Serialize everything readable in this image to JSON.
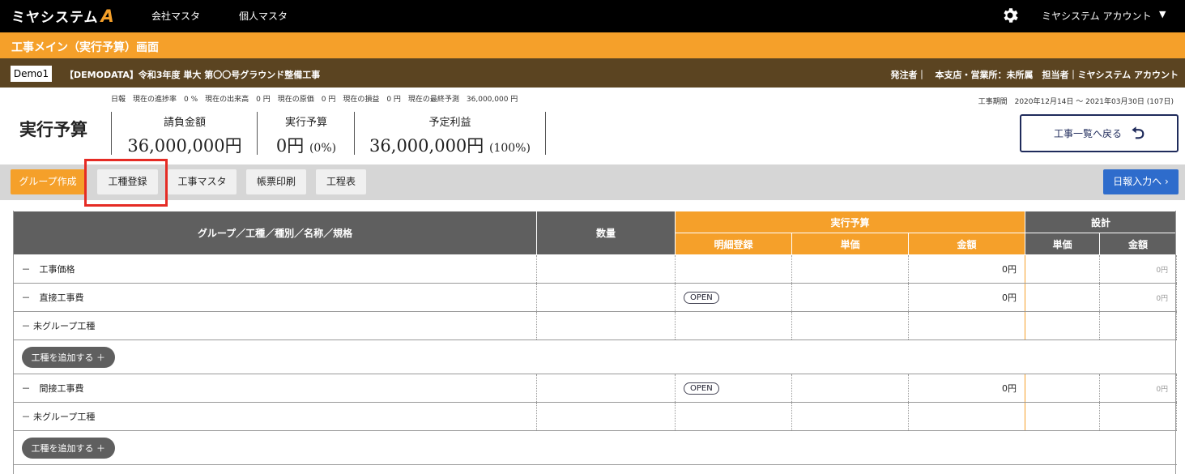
{
  "app": {
    "logo_text": "ミヤシステム",
    "logo_mark": "A"
  },
  "nav": {
    "items": [
      "会社マスタ",
      "個人マスタ"
    ]
  },
  "account": {
    "name": "ミヤシステム アカウント",
    "caret": "▼"
  },
  "screen_title": "工事メイン（実行予算）画面",
  "project_bar": {
    "demo_label": "Demo1",
    "project_name": "【DEMODATA】令和3年度 単大 第〇〇号グラウンド整備工事",
    "right_info": "発注者｜　本支店・営業所：未所属　担当者｜ミヤシステム アカウント"
  },
  "summary": {
    "status_line": "日報　現在の進捗率　0 %　現在の出来高　0 円　現在の原価　0 円　現在の損益　0 円　現在の最終予測　36,000,000 円",
    "period": "工事期間　2020年12月14日 〜 2021年03月30日 (107日)",
    "page_title": "実行予算",
    "metrics": [
      {
        "label": "請負金額",
        "value": "36,000,000円",
        "pct": ""
      },
      {
        "label": "実行予算",
        "value": "0円",
        "pct": "(0%)"
      },
      {
        "label": "予定利益",
        "value": "36,000,000円",
        "pct": "(100%)"
      }
    ],
    "back_button": "工事一覧へ戻る",
    "back_icon": "return-arrow-icon"
  },
  "toolbar": {
    "group_create": "グループ作成",
    "koshu_register": "工種登録",
    "koji_master": "工事マスタ",
    "report_print": "帳票印刷",
    "schedule": "工程表",
    "daily_input": "日報入力へ",
    "daily_input_arrow": "›"
  },
  "table": {
    "headers": {
      "name": "グループ／工種／種別／名称／規格",
      "qty": "数量",
      "budget": "実行予算",
      "detail": "明細登録",
      "unit_price": "単価",
      "amount": "金額",
      "design": "設計",
      "design_unit_price": "単価",
      "design_amount": "金額"
    },
    "rows": [
      {
        "name": "－　工事価格",
        "detail": "",
        "amount": "0円",
        "design_amount": "0円"
      },
      {
        "name": "－　直接工事費",
        "detail": "OPEN",
        "amount": "0円",
        "design_amount": "0円"
      },
      {
        "name": "－ 未グループ工種",
        "detail": "",
        "amount": "",
        "design_amount": ""
      },
      {
        "name": "－　間接工事費",
        "detail": "OPEN",
        "amount": "0円",
        "design_amount": "0円"
      },
      {
        "name": "－ 未グループ工種",
        "detail": "",
        "amount": "",
        "design_amount": ""
      }
    ],
    "add_button": "工種を追加する ＋"
  },
  "colors": {
    "orange": "#f5a02a",
    "brown": "#5b4421",
    "navy": "#1f2b5b",
    "blue": "#2e6ccc",
    "highlight": "#e52b24"
  }
}
